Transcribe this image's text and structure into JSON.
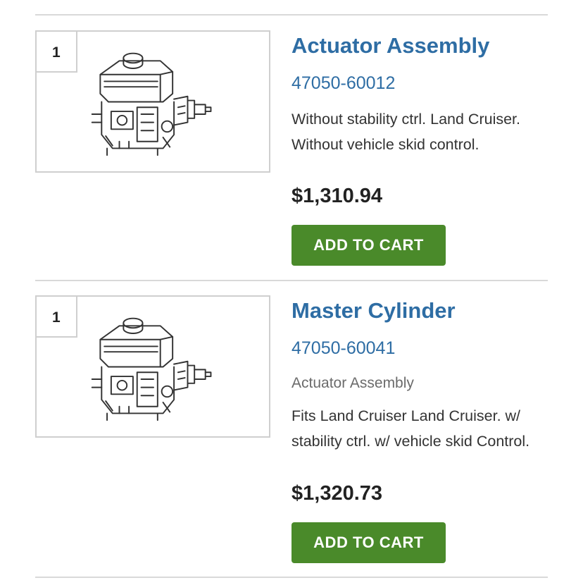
{
  "items": [
    {
      "callout": "1",
      "image_icon": "brake-actuator-drawing",
      "title": "Actuator Assembly",
      "part_number": "47050-60012",
      "subtitle": "",
      "description": "Without stability ctrl. Land Cruiser. Without vehicle skid control.",
      "price": "$1,310.94",
      "button_label": "ADD TO CART"
    },
    {
      "callout": "1",
      "image_icon": "brake-actuator-drawing",
      "title": "Master Cylinder",
      "part_number": "47050-60041",
      "subtitle": "Actuator Assembly",
      "description": "Fits Land Cruiser Land Cruiser. w/ stability ctrl. w/ vehicle skid Control.",
      "price": "$1,320.73",
      "button_label": "ADD TO CART"
    }
  ],
  "colors": {
    "link_blue": "#2e6da4",
    "button_green": "#4a8a2a",
    "divider_gray": "#d9d9d9"
  }
}
